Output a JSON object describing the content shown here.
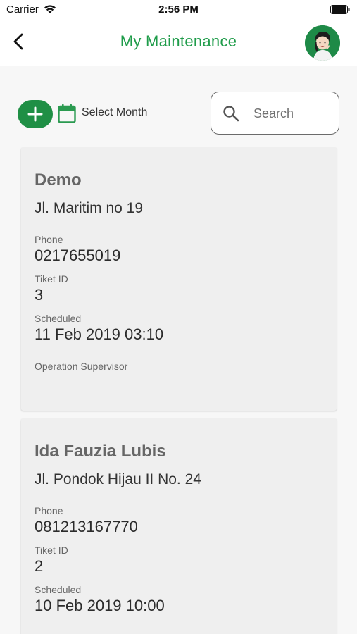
{
  "status_bar": {
    "carrier": "Carrier",
    "time": "2:56 PM",
    "wifi_icon": "wifi-icon",
    "battery_icon": "battery-icon"
  },
  "header": {
    "title": "My Maintenance",
    "back_icon": "chevron-left-icon",
    "avatar_icon": "user-avatar",
    "accent_color": "#1f9c4a"
  },
  "toolbar": {
    "add_icon": "plus-icon",
    "calendar_icon": "calendar-icon",
    "select_month_label": "Select Month",
    "search_placeholder": "Search",
    "search_value": ""
  },
  "tickets": [
    {
      "name": "Demo",
      "address": "Jl. Maritim no 19",
      "phone_label": "Phone",
      "phone": "0217655019",
      "ticket_id_label": "Tiket ID",
      "ticket_id": "3",
      "scheduled_label": "Scheduled",
      "scheduled": "11 Feb 2019  03:10",
      "role": "Operation Supervisor"
    },
    {
      "name": "Ida Fauzia Lubis",
      "address": "Jl. Pondok Hijau II No. 24",
      "phone_label": "Phone",
      "phone": "081213167770",
      "ticket_id_label": "Tiket ID",
      "ticket_id": "2",
      "scheduled_label": "Scheduled",
      "scheduled": "10 Feb 2019  10:00"
    }
  ]
}
